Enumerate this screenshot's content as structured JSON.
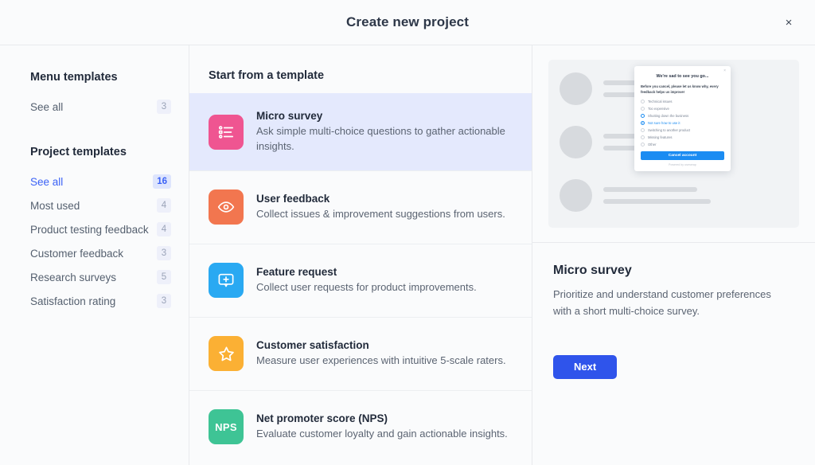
{
  "header": {
    "title": "Create new project",
    "close_label": "×"
  },
  "sidebar": {
    "menu_templates_heading": "Menu templates",
    "menu_templates_items": [
      {
        "label": "See all",
        "count": "3",
        "active": false
      }
    ],
    "project_templates_heading": "Project templates",
    "project_templates_items": [
      {
        "label": "See all",
        "count": "16",
        "active": true
      },
      {
        "label": "Most used",
        "count": "4",
        "active": false
      },
      {
        "label": "Product testing feedback",
        "count": "4",
        "active": false
      },
      {
        "label": "Customer feedback",
        "count": "3",
        "active": false
      },
      {
        "label": "Research surveys",
        "count": "5",
        "active": false
      },
      {
        "label": "Satisfaction rating",
        "count": "3",
        "active": false
      }
    ]
  },
  "templates_panel": {
    "heading": "Start from a template",
    "items": [
      {
        "title": "Micro survey",
        "description": "Ask simple multi-choice questions to gather actionable insights.",
        "icon": "list-icon",
        "color": "#ef5591",
        "selected": true
      },
      {
        "title": "User feedback",
        "description": "Collect issues & improvement suggestions from users.",
        "icon": "eye-icon",
        "color": "#f2764f",
        "selected": false
      },
      {
        "title": "Feature request",
        "description": "Collect user requests for product improvements.",
        "icon": "message-plus-icon",
        "color": "#29a9f2",
        "selected": false
      },
      {
        "title": "Customer satisfaction",
        "description": "Measure user experiences with intuitive 5-scale raters.",
        "icon": "star-icon",
        "color": "#fbb034",
        "selected": false
      },
      {
        "title": "Net promoter score (NPS)",
        "description": "Evaluate customer loyalty and gain actionable insights.",
        "icon": "nps-icon",
        "color": "#3ec495",
        "selected": false
      }
    ]
  },
  "preview": {
    "mock": {
      "close_label": "×",
      "title": "We're sad to see you go...",
      "subtitle": "Before you cancel, please let us know why, every feedback helps us improve!",
      "options": [
        {
          "label": "Technical issues",
          "state": "normal"
        },
        {
          "label": "Too expensive",
          "state": "normal"
        },
        {
          "label": "Shutting down the business",
          "state": "hover"
        },
        {
          "label": "Not sure how to use it",
          "state": "checked"
        },
        {
          "label": "Switching to another product",
          "state": "normal"
        },
        {
          "label": "Missing features",
          "state": "normal"
        },
        {
          "label": "Other",
          "state": "normal"
        }
      ],
      "button_label": "Cancel account",
      "footer_label": "Powered by  userwrap"
    }
  },
  "detail": {
    "title": "Micro survey",
    "description": "Prioritize and understand customer preferences with a short multi-choice survey.",
    "next_label": "Next"
  },
  "colors": {
    "accent": "#2f54eb",
    "link": "#3b62f6",
    "selected_row": "#e4e9fd",
    "mock_accent": "#1b8cf2"
  }
}
